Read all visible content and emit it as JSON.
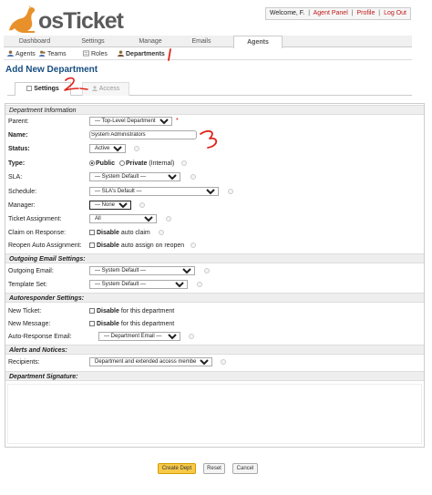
{
  "header": {
    "logo_text": "osTicket",
    "welcome_text": "Welcome, F.",
    "links": [
      "Agent Panel",
      "Profile",
      "Log Out"
    ]
  },
  "topnav": {
    "tabs": [
      {
        "label": "Dashboard"
      },
      {
        "label": "Settings"
      },
      {
        "label": "Manage"
      },
      {
        "label": "Emails"
      },
      {
        "label": "Agents",
        "active": true
      }
    ]
  },
  "subnav": {
    "items": [
      {
        "label": "Agents",
        "icon": "user-icon"
      },
      {
        "label": "Teams",
        "icon": "team-icon"
      },
      {
        "label": "Roles",
        "icon": "role-icon"
      },
      {
        "label": "Departments",
        "icon": "department-icon",
        "active": true
      }
    ]
  },
  "page": {
    "title": "Add New Department"
  },
  "form_tabs": [
    {
      "label": "Settings",
      "active": true
    },
    {
      "label": "Access"
    }
  ],
  "form": {
    "section_department_info": "Department Information",
    "parent": {
      "label": "Parent:",
      "value": "— Top-Level Department —"
    },
    "name": {
      "label": "Name:",
      "value": "System Administrators"
    },
    "status": {
      "label": "Status:",
      "value": "Active"
    },
    "type": {
      "label": "Type:",
      "public_label": "Public",
      "private_label": "Private",
      "private_note": "(Internal)"
    },
    "sla": {
      "label": "SLA:",
      "value": "— System Default —"
    },
    "schedule": {
      "label": "Schedule:",
      "value": "— SLA's Default —"
    },
    "manager": {
      "label": "Manager:",
      "value": "— None —"
    },
    "ticket_assignment": {
      "label": "Ticket Assignment:",
      "value": "All"
    },
    "claim_on_response": {
      "label": "Claim on Response:",
      "bold": "Disable",
      "text": "auto claim"
    },
    "reopen_auto_assignment": {
      "label": "Reopen Auto Assignment:",
      "bold": "Disable",
      "text": "auto assign on reopen"
    },
    "section_outgoing_email": "Outgoing Email Settings:",
    "outgoing_email": {
      "label": "Outgoing Email:",
      "value": "— System Default —"
    },
    "template_set": {
      "label": "Template Set:",
      "value": "— System Default —"
    },
    "section_autoresponder": "Autoresponder Settings:",
    "new_ticket": {
      "label": "New Ticket:",
      "bold": "Disable",
      "text": "for this department"
    },
    "new_message": {
      "label": "New Message:",
      "bold": "Disable",
      "text": "for this department"
    },
    "auto_response_email": {
      "label": "Auto-Response Email:",
      "value": "— Department Email —"
    },
    "section_alerts": "Alerts and Notices:",
    "recipients": {
      "label": "Recipients:",
      "value": "Department and extended access members"
    },
    "section_signature": "Department Signature:"
  },
  "buttons": {
    "create": "Create Dept",
    "reset": "Reset",
    "cancel": "Cancel"
  },
  "annotations": [
    "1",
    "2",
    "3"
  ],
  "colors": {
    "title": "#184e81",
    "link": "#c01919",
    "primary_button": "#f7c948",
    "annotation": "#e0241b"
  }
}
